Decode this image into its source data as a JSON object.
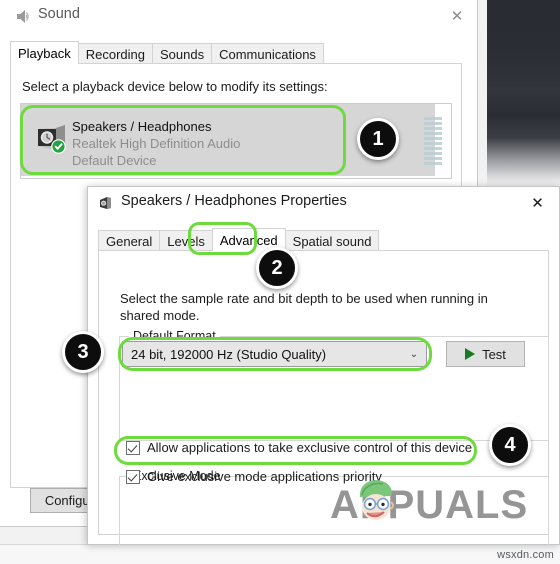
{
  "desktop": {
    "credit": "wsxdn.com"
  },
  "sound_window": {
    "title": "Sound",
    "title_icon": "speaker-icon",
    "close_label": "✕",
    "tabs": [
      {
        "label": "Playback",
        "active": true
      },
      {
        "label": "Recording",
        "active": false
      },
      {
        "label": "Sounds",
        "active": false
      },
      {
        "label": "Communications",
        "active": false
      }
    ],
    "playback": {
      "hint": "Select a playback device below to modify its settings:",
      "device": {
        "name": "Speakers / Headphones",
        "driver": "Realtek High Definition Audio",
        "status": "Default Device",
        "icon": "speaker-default-icon",
        "badge_icon": "green-check-icon",
        "meter_segments": 10
      }
    },
    "configure_button": "Configure"
  },
  "properties_window": {
    "title": "Speakers / Headphones Properties",
    "title_icon": "speaker-icon",
    "close_label": "✕",
    "tabs": [
      {
        "label": "General",
        "active": false
      },
      {
        "label": "Levels",
        "active": false
      },
      {
        "label": "Advanced",
        "active": true
      },
      {
        "label": "Spatial sound",
        "active": false
      }
    ],
    "default_format": {
      "group_title": "Default Format",
      "description": "Select the sample rate and bit depth to be used when running in shared mode.",
      "selected_value": "24 bit, 192000 Hz (Studio Quality)",
      "dropdown_arrow": "⌄",
      "test_button": "Test",
      "test_icon": "play-icon"
    },
    "exclusive_mode": {
      "group_title": "Exclusive Mode",
      "checkboxes": [
        {
          "label": "Allow applications to take exclusive control of this device",
          "checked": true
        },
        {
          "label": "Give exclusive mode applications priority",
          "checked": true
        }
      ]
    }
  },
  "annotations": {
    "highlight_color": "#6ddb3e",
    "badges": [
      {
        "number": "1",
        "target": "playback-device-row"
      },
      {
        "number": "2",
        "target": "advanced-tab"
      },
      {
        "number": "3",
        "target": "default-format-dropdown"
      },
      {
        "number": "4",
        "target": "exclusive-control-checkbox"
      }
    ]
  },
  "watermark": {
    "text": "APPUALS",
    "face_icon": "mascot-face-icon"
  }
}
